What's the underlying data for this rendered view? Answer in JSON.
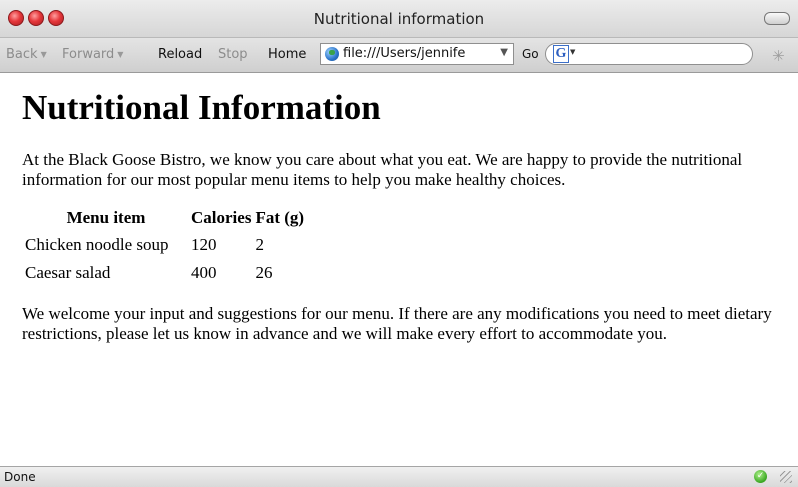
{
  "window": {
    "title": "Nutritional information"
  },
  "toolbar": {
    "back_label": "Back",
    "forward_label": "Forward",
    "reload_label": "Reload",
    "stop_label": "Stop",
    "home_label": "Home",
    "address": "file:///Users/jennife",
    "go_label": "Go",
    "search_value": ""
  },
  "page": {
    "heading": "Nutritional Information",
    "intro": "At the Black Goose Bistro, we know you care about what you eat. We are happy to provide the nutritional information for our most popular menu items to help you make healthy choices.",
    "table": {
      "headers": [
        "Menu item",
        "Calories",
        "Fat (g)"
      ],
      "rows": [
        [
          "Chicken noodle soup",
          "120",
          "2"
        ],
        [
          "Caesar salad",
          "400",
          "26"
        ]
      ]
    },
    "outro": "We welcome your input and suggestions for our menu. If there are any modifications you need to meet dietary restrictions, please let us know in advance and we will make every effort to accommodate you."
  },
  "statusbar": {
    "text": "Done"
  },
  "icons": {
    "close": "close-button-icon",
    "minimize": "minimize-button-icon",
    "zoom": "zoom-button-icon",
    "toolbar_toggle": "toolbar-toggle-icon",
    "globe": "globe-icon",
    "google": "google-icon",
    "spinner": "activity-spinner-icon",
    "secure": "check-icon",
    "resize": "resize-grip-icon"
  },
  "colors": {
    "window_buttons": "#e5373b",
    "status_check": "#38a620"
  }
}
